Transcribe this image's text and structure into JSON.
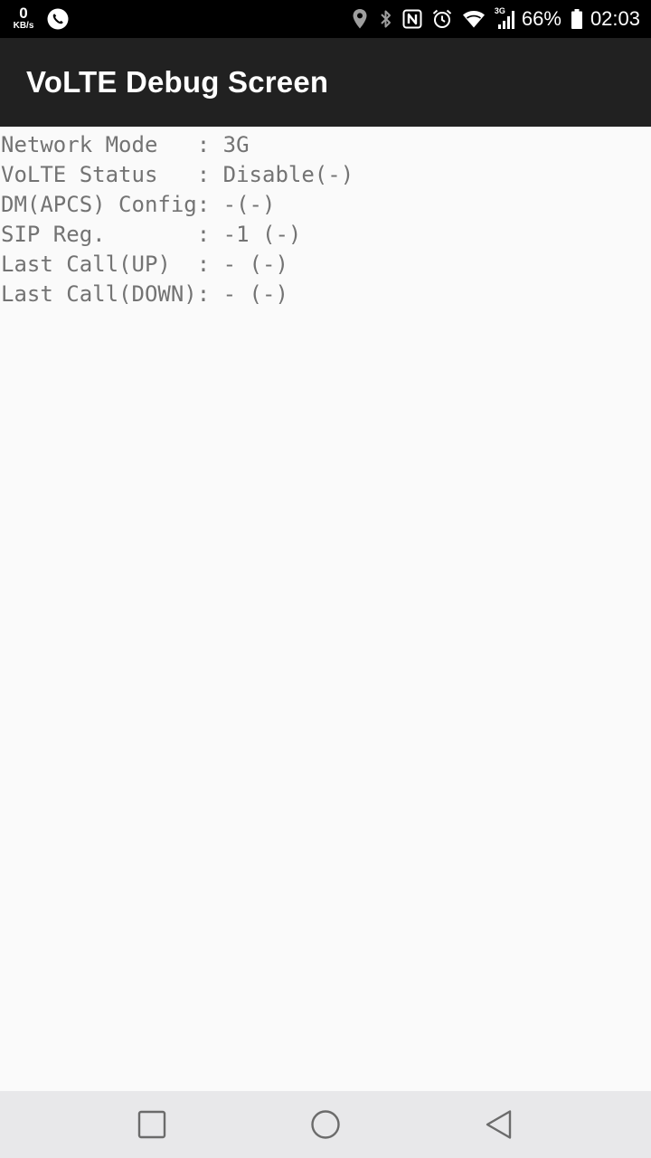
{
  "status_bar": {
    "speed_value": "0",
    "speed_unit": "KB/s",
    "network_type": "3G",
    "battery_percent": "66%",
    "time": "02:03",
    "icons": [
      "phone-call-icon",
      "location-icon",
      "bluetooth-icon",
      "nfc-icon",
      "alarm-icon",
      "wifi-icon",
      "cell-signal-icon",
      "battery-icon"
    ]
  },
  "toolbar": {
    "title": "VoLTE Debug Screen"
  },
  "info": {
    "rows": [
      {
        "label": "Network Mode   ",
        "value": ": 3G"
      },
      {
        "label": "VoLTE Status   ",
        "value": ": Disable(-)"
      },
      {
        "label": "DM(APCS) Config",
        "value": ": -(-)"
      },
      {
        "label": "SIP Reg.       ",
        "value": ": -1 (-)"
      },
      {
        "label": "Last Call(UP)  ",
        "value": ": - (-)"
      },
      {
        "label": "Last Call(DOWN)",
        "value": ": - (-)"
      }
    ]
  },
  "nav_bar": {
    "buttons": [
      "recents-icon",
      "home-icon",
      "back-icon"
    ]
  },
  "colors": {
    "status_bar": "#000000",
    "toolbar": "#212121",
    "background": "#fafafa",
    "text": "#737373",
    "nav_bar": "#e8e8ea"
  }
}
